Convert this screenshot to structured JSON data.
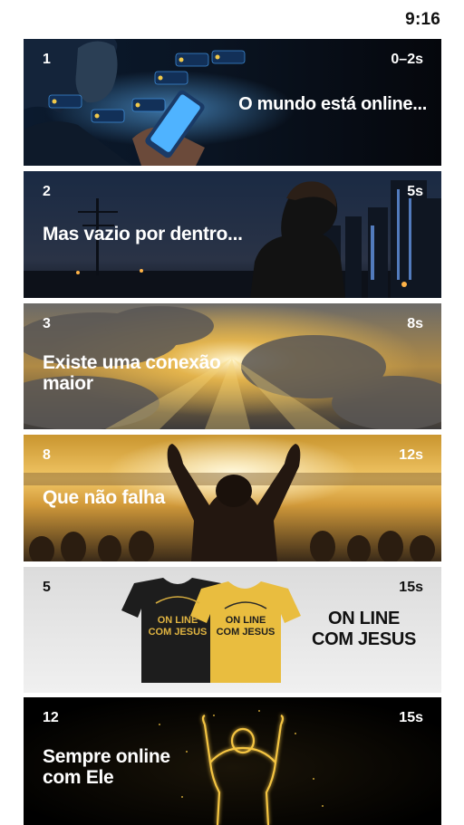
{
  "status_bar": {
    "time": "9:16"
  },
  "scenes": [
    {
      "number": "1",
      "duration": "0–2s",
      "caption": "O mundo está online..."
    },
    {
      "number": "2",
      "duration": "5s",
      "caption": "Mas vazio por dentro..."
    },
    {
      "number": "3",
      "duration": "8s",
      "caption": "Existe uma conexão\nmaior"
    },
    {
      "number": "8",
      "duration": "12s",
      "caption": "Que não falha"
    },
    {
      "number": "5",
      "duration": "15s",
      "caption": "ON LINE\nCOM JESUS",
      "shirt_print": [
        "ON LINE",
        "COM JESUS"
      ]
    },
    {
      "number": "12",
      "duration": "15s",
      "caption": "Sempre online\ncom Ele"
    }
  ],
  "colors": {
    "shirt_black": "#1d1d1d",
    "shirt_yellow": "#e9bd3f",
    "glow": "#f5c542",
    "night": "#0d1526"
  }
}
